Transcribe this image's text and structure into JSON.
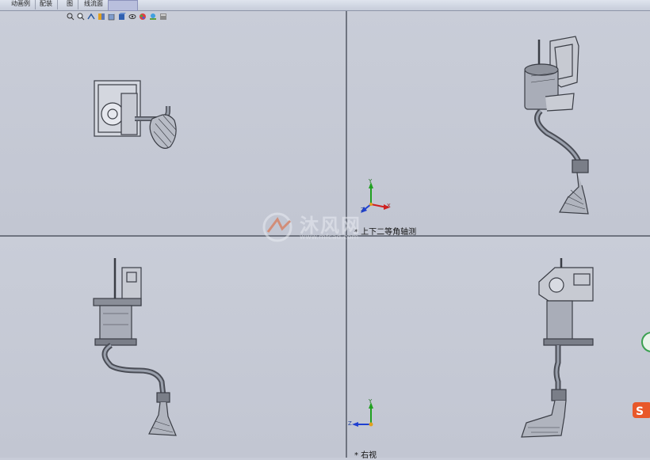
{
  "tabs": [
    {
      "label": "动画例"
    },
    {
      "label": "配装"
    },
    {
      "label": "图"
    },
    {
      "label": "线流面"
    }
  ],
  "hud_icons": [
    "zoom-to-fit-icon",
    "zoom-area-icon",
    "previous-view-icon",
    "section-view-icon",
    "view-orientation-icon",
    "display-style-icon",
    "hide-show-icon",
    "edit-appearance-icon",
    "apply-scene-icon",
    "view-settings-icon"
  ],
  "views": {
    "top_right_label": "* 上下二等角轴测",
    "bottom_right_label": "* 右视"
  },
  "triad": {
    "y": "Y",
    "z": "Z",
    "x": "X"
  },
  "watermark": {
    "text": "沐风网",
    "sub": "www.mfcad.com"
  },
  "colors": {
    "viewport_bg": "#c8ccd8",
    "model": "#3a3d45",
    "axis_x": "#d02020",
    "axis_y": "#20a020",
    "axis_z": "#2040d0"
  }
}
